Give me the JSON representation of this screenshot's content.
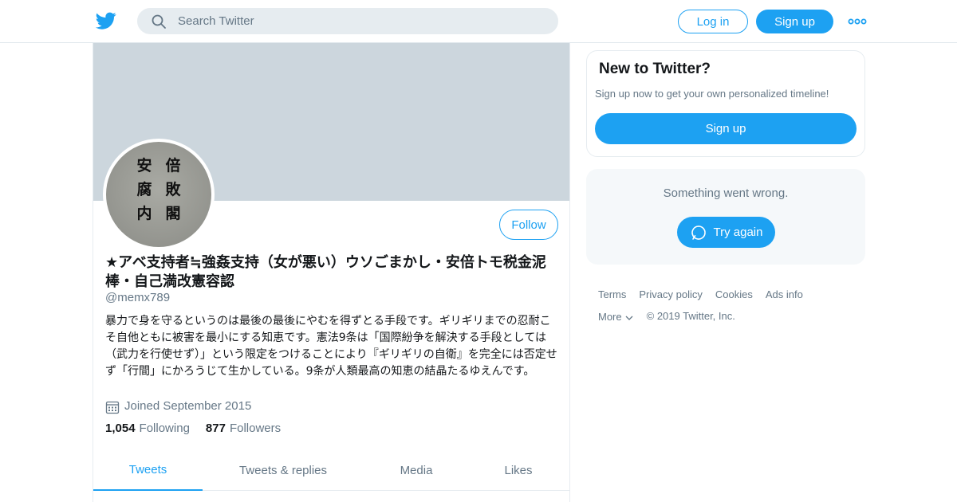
{
  "header": {
    "search_placeholder": "Search Twitter",
    "login_label": "Log in",
    "signup_label": "Sign up",
    "brand_color": "#1da1f2"
  },
  "profile": {
    "avatar_text": [
      "安",
      "倍",
      "腐",
      "敗",
      "内",
      "閣"
    ],
    "follow_label": "Follow",
    "display_name": "★アベ支持者≒強姦支持（女が悪い）ウソごまかし・安倍トモ税金泥棒・自己満改憲容認",
    "handle": "@memx789",
    "bio": "暴力で身を守るというのは最後の最後にやむを得ずとる手段です。ギリギリまでの忍耐こそ自他ともに被害を最小にする知恵です。憲法9条は「国際紛争を解決する手段としては（武力を行使せず）」という限定をつけることにより『ギリギリの自衛』を完全には否定せず「行間」にかろうじて生かしている。9条が人類最高の知恵の結晶たるゆえんです。",
    "joined": "Joined September 2015",
    "following_count": "1,054",
    "following_label": "Following",
    "followers_count": "877",
    "followers_label": "Followers"
  },
  "tabs": [
    {
      "label": "Tweets",
      "active": true
    },
    {
      "label": "Tweets & replies",
      "active": false
    },
    {
      "label": "Media",
      "active": false
    },
    {
      "label": "Likes",
      "active": false
    }
  ],
  "sidebar": {
    "new_title": "New to Twitter?",
    "new_subtitle": "Sign up now to get your own personalized timeline!",
    "signup_label": "Sign up",
    "error_message": "Something went wrong.",
    "try_again_label": "Try again"
  },
  "footer": {
    "links": [
      "Terms",
      "Privacy policy",
      "Cookies",
      "Ads info"
    ],
    "more_label": "More",
    "copyright": "© 2019 Twitter, Inc."
  }
}
